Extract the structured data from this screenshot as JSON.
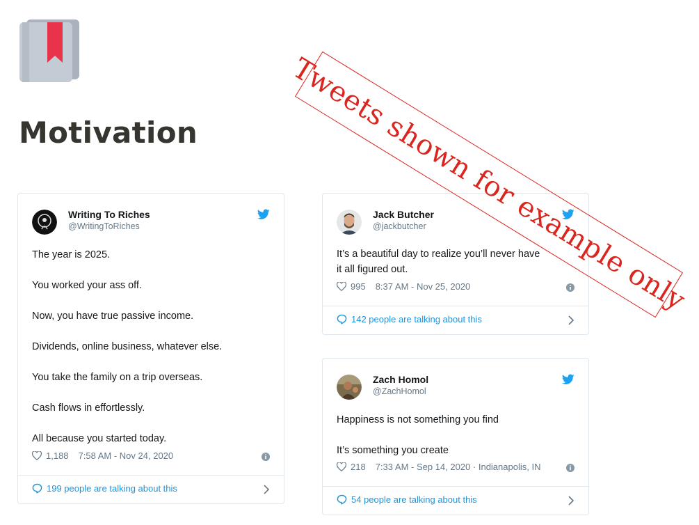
{
  "page": {
    "title": "Motivation",
    "icon": "bookmark-book-icon"
  },
  "watermark": {
    "text": "Tweets shown for example only",
    "color": "#d9261f"
  },
  "colors": {
    "link": "#1b95e0",
    "twitter_blue": "#1da1f2",
    "muted": "#657786"
  },
  "tweets": [
    {
      "name": "Writing To Riches",
      "handle": "@WritingToRiches",
      "paragraphs": [
        "The year is 2025.",
        "You worked your ass off.",
        "Now, you have true passive income.",
        "Dividends, online business, whatever else.",
        "You take the family on a trip overseas.",
        "Cash flows in effortlessly.",
        "All because you started today."
      ],
      "likes": "1,188",
      "timestamp": "7:58 AM - Nov 24, 2020",
      "footer": "199 people are talking about this"
    },
    {
      "name": "Jack Butcher",
      "handle": "@jackbutcher",
      "paragraphs": [
        "It’s a beautiful day to realize you’ll never have it all figured out."
      ],
      "likes": "995",
      "timestamp": "8:37 AM - Nov 25, 2020",
      "footer": "142 people are talking about this"
    },
    {
      "name": "Zach Homol",
      "handle": "@ZachHomol",
      "paragraphs": [
        "Happiness is not something you find",
        "It’s something you create"
      ],
      "likes": "218",
      "timestamp": "7:33 AM - Sep 14, 2020 · Indianapolis, IN",
      "footer": "54 people are talking about this"
    }
  ]
}
